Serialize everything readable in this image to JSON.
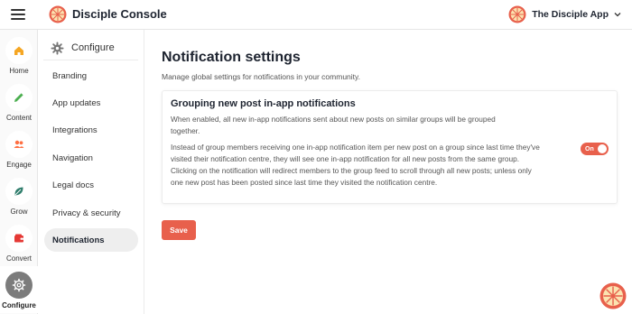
{
  "header": {
    "brand_title": "Disciple Console",
    "app_name": "The Disciple App",
    "menu_icon": "hamburger-icon",
    "logo_icon": "orange-slice-logo"
  },
  "rail": {
    "items": [
      {
        "label": "Home",
        "icon": "home-icon"
      },
      {
        "label": "Content",
        "icon": "pencil-icon"
      },
      {
        "label": "Engage",
        "icon": "people-icon"
      },
      {
        "label": "Grow",
        "icon": "leaf-icon"
      },
      {
        "label": "Convert",
        "icon": "wallet-icon"
      },
      {
        "label": "Configure",
        "icon": "gear-icon",
        "active": true
      }
    ]
  },
  "submenu": {
    "heading": "Configure",
    "items": [
      {
        "label": "Branding"
      },
      {
        "label": "App updates"
      },
      {
        "label": "Integrations"
      },
      {
        "label": "Navigation"
      },
      {
        "label": "Legal docs"
      },
      {
        "label": "Privacy & security"
      },
      {
        "label": "Notifications",
        "active": true
      }
    ]
  },
  "main": {
    "title": "Notification settings",
    "subtitle": "Manage global settings for notifications in your community.",
    "card": {
      "title": "Grouping new post in-app notifications",
      "description": "When enabled, all new in-app notifications sent about new posts on similar groups will be grouped together.",
      "body": "Instead of group members receiving one in-app notification item per new post on a group since last time they've visited their notification centre, they will see one in-app notification for all new posts from the same group. Clicking on the notification will redirect members to the group feed to scroll through all new posts; unless only one new post has been posted since last time they visited the notification centre.",
      "toggle_label": "On",
      "toggle_state": true
    },
    "save_label": "Save"
  },
  "colors": {
    "accent": "#e8604c",
    "rail_home": "#f5a623",
    "rail_content": "#4caf50",
    "rail_engage": "#ff7043",
    "rail_grow": "#2e7d6b",
    "rail_convert": "#e53935",
    "logo_orange": "#f08a2a"
  }
}
